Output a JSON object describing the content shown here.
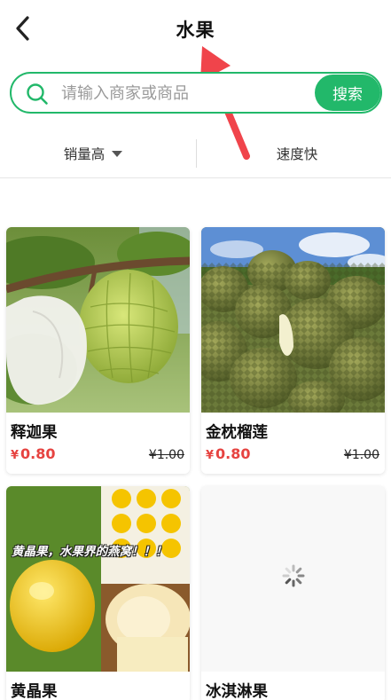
{
  "header": {
    "title": "水果"
  },
  "search": {
    "placeholder": "请输入商家或商品",
    "button_label": "搜索"
  },
  "sort": {
    "sales_label": "销量高",
    "speed_label": "速度快"
  },
  "products": [
    {
      "name": "释迦果",
      "price": "0.80",
      "original_price": "¥1.00"
    },
    {
      "name": "金枕榴莲",
      "price": "0.80",
      "original_price": "¥1.00"
    },
    {
      "name": "黄晶果",
      "image_caption": "黄晶果，水果界的燕窝！！！"
    },
    {
      "name": "冰淇淋果"
    }
  ],
  "currency_symbol": "¥",
  "colors": {
    "accent_green": "#22b86a",
    "price_red": "#e64340",
    "annotation_red": "#f0444b"
  }
}
